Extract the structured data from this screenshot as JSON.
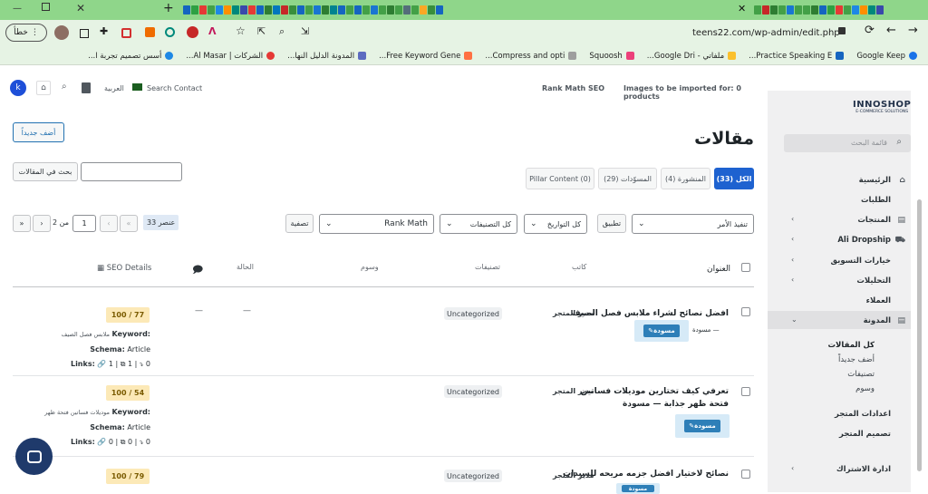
{
  "browser": {
    "back_label": "خطأ",
    "url": "teens22.com/wp-admin/edit.php",
    "bookmarks": [
      "Google Keep",
      "Practice Speaking E...",
      "ملفاتي - Google Dri...",
      "Squoosh",
      "Compress and opti...",
      "Free Keyword Gene...",
      "المدونة الدليل النها...",
      "الشركات | Al Masar...",
      "أسس تصميم تجربة ا..."
    ],
    "tab_icon_colors": [
      "#1565c0",
      "#2ea043",
      "#e53935",
      "#43a047",
      "#1e88e5",
      "#ff8f00",
      "#00897b",
      "#3949ab",
      "#e53935",
      "#1565c0",
      "#2e7d32",
      "#0277bd",
      "#c62828",
      "#388e3c",
      "#1565c0",
      "#43a047",
      "#1976d2",
      "#2e7d32",
      "#00838f",
      "#1565c0",
      "#43a047",
      "#1565c0",
      "#43a047",
      "#1976d2",
      "#43a047",
      "#2e7d32",
      "#43a047",
      "#546e7a",
      "#43a047",
      "#f9a825",
      "#388e3c",
      "#1565c0",
      "#43a047",
      "#c62828",
      "#2e7d32",
      "#43a047",
      "#1976d2",
      "#43a047",
      "#43a047",
      "#2e7d32"
    ]
  },
  "adminbar": {
    "avatar_letter": "k",
    "language": "العربية",
    "search_contact": "Search Contact",
    "rankmath": "Rank Math SEO",
    "images_notice": "Images to be imported for: 0 products"
  },
  "sidebar": {
    "logo_main": "INNOSHOP",
    "logo_sub": "E-COMMERCE SOLUTIONS",
    "search_placeholder": "قائمة البحث",
    "items": [
      {
        "label": "الرئيسية"
      },
      {
        "label": "الطلبات"
      },
      {
        "label": "المنتجات"
      },
      {
        "label": "Ali Dropship"
      },
      {
        "label": "خيارات التسويق"
      },
      {
        "label": "التحليلات"
      },
      {
        "label": "العملاء"
      },
      {
        "label": "المدونة"
      },
      {
        "label": "اعدادات المتجر"
      },
      {
        "label": "تصميم المتجر"
      },
      {
        "label": "ادارة الاشتراك"
      }
    ],
    "blog_sub": [
      "كل المقالات",
      "أضف جديداً",
      "تصنيفات",
      "وسوم"
    ]
  },
  "page": {
    "title": "مقالات",
    "add_new": "أضف جديداً",
    "search_button": "بحث في المقالات",
    "search_value": "",
    "tabs": {
      "all": "الكل (33)",
      "published": "المنشورة (4)",
      "drafts": "المسوّدات (29)",
      "pillar": "Pillar Content (0)"
    },
    "bulk_action": "تنفيذ الأمر",
    "apply": "تطبيق",
    "all_dates": "كل التواريخ",
    "all_categories": "كل التصنيفات",
    "rankmath_filter": "Rank Math",
    "filter": "تصفية",
    "items_count": "33 عنصر",
    "pagination": {
      "first": "«",
      "prev": "‹",
      "current": "1",
      "of": "من 2",
      "next": "›",
      "last": "»"
    }
  },
  "table": {
    "headers": {
      "title": "العنوان",
      "author": "كاتب",
      "categories": "تصنيفات",
      "tags": "وسوم",
      "status": "الحالة",
      "seo": "SEO Details"
    },
    "rows": [
      {
        "title": "افضل نصائح لشراء ملابس فصل الصيف",
        "title_line2": "",
        "draft": "— مسودة",
        "status_button": "مسودة",
        "author": "مدير المتجر",
        "category": "Uncategorized",
        "score": "100 / 77",
        "keyword_label": "Keyword:",
        "keyword": "ملابس فصل الصيف",
        "schema_label": "Schema:",
        "schema": "Article",
        "links_label": "Links:",
        "links": [
          "1",
          "1",
          "0"
        ],
        "tags": "—",
        "status": "—"
      },
      {
        "title": "تعرفي كيف تختارين موديلات فساتين",
        "title_line2": "فتحة ظهر جذابة — مسودة",
        "draft": "",
        "status_button": "مسودة",
        "author": "مدير المتجر",
        "category": "Uncategorized",
        "score": "100 / 54",
        "keyword_label": "Keyword:",
        "keyword": "موديلات فساتين فتحة ظهر",
        "schema_label": "Schema:",
        "schema": "Article",
        "links_label": "Links:",
        "links": [
          "0",
          "0",
          "0"
        ],
        "tags": "—",
        "status": "—"
      },
      {
        "title": "نصائح لاختيار افضل جزمه مريحه للسيدات",
        "title_line2": "",
        "draft": "",
        "status_button": "مسودة",
        "author": "مدير المتجر",
        "category": "Uncategorized",
        "score": "100 / 79",
        "keyword_label": "",
        "keyword": "",
        "schema_label": "",
        "schema": "",
        "links_label": "",
        "links": [],
        "tags": "",
        "status": ""
      }
    ]
  },
  "colors": {
    "primary": "#2271b1",
    "status_button": "#2e7fb8",
    "score_bg": "#fce9b7",
    "sidebar_bg": "#f0f0f1"
  }
}
